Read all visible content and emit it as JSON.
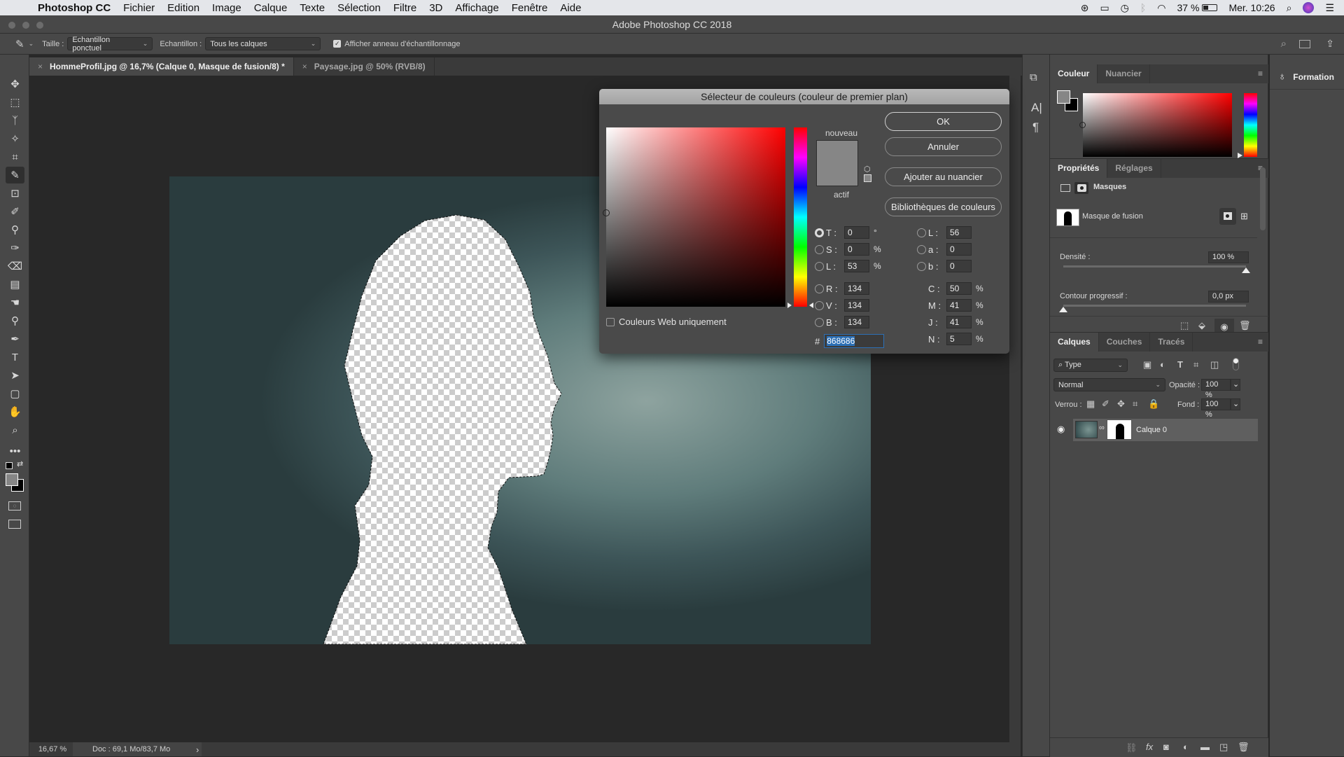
{
  "menubar": {
    "app": "Photoshop CC",
    "items": [
      "Fichier",
      "Edition",
      "Image",
      "Calque",
      "Texte",
      "Sélection",
      "Filtre",
      "3D",
      "Affichage",
      "Fenêtre",
      "Aide"
    ],
    "battery": "37 %",
    "clock": "Mer. 10:26"
  },
  "window": {
    "title": "Adobe Photoshop CC 2018"
  },
  "options": {
    "size_label": "Taille :",
    "size_value": "Echantillon ponctuel",
    "sample_label": "Echantillon :",
    "sample_value": "Tous les calques",
    "show_ring_label": "Afficher anneau d'échantillonnage",
    "show_ring_checked": true
  },
  "tabs": [
    {
      "label": "HommeProfil.jpg @ 16,7% (Calque 0, Masque de fusion/8) *",
      "active": true
    },
    {
      "label": "Paysage.jpg @ 50% (RVB/8)",
      "active": false
    }
  ],
  "status": {
    "zoom": "16,67 %",
    "doc": "Doc : 69,1 Mo/83,7 Mo",
    "arrow": "›"
  },
  "tools": [
    "move-icon",
    "marquee-icon",
    "lasso-icon",
    "magic-wand-icon",
    "crop-icon",
    "eyedropper-icon",
    "frame-icon",
    "brush-icon",
    "stamp-icon",
    "history-brush-icon",
    "eraser-icon",
    "gradient-icon",
    "smudge-icon",
    "dodge-icon",
    "pen-icon",
    "type-icon",
    "path-select-icon",
    "shape-icon",
    "hand-icon",
    "zoom-icon",
    "more-icon"
  ],
  "tool_glyphs": [
    "✥",
    "⬚",
    "ᛉ",
    "✧",
    "⌗",
    "✎",
    "⊡",
    "✐",
    "⚲",
    "✑",
    "⌫",
    "▤",
    "☚",
    "⚲",
    "✒",
    "T",
    "➤",
    "▢",
    "✋",
    "⌕",
    "•••"
  ],
  "colors": {
    "foreground": "#868686",
    "background": "#000000",
    "highlight": "#2c6fb5"
  },
  "dialog": {
    "title": "Sélecteur de couleurs (couleur de premier plan)",
    "buttons": {
      "ok": "OK",
      "cancel": "Annuler",
      "add_swatch": "Ajouter au nuancier",
      "libraries": "Bibliothèques de couleurs"
    },
    "new_label": "nouveau",
    "current_label": "actif",
    "web_only_label": "Couleurs Web uniquement",
    "web_only_checked": false,
    "hsb": [
      {
        "label": "T :",
        "value": "0",
        "unit": "°",
        "selected": true
      },
      {
        "label": "S :",
        "value": "0",
        "unit": "%",
        "selected": false
      },
      {
        "label": "L :",
        "value": "53",
        "unit": "%",
        "selected": false
      }
    ],
    "rgb": [
      {
        "label": "R :",
        "value": "134"
      },
      {
        "label": "V :",
        "value": "134"
      },
      {
        "label": "B :",
        "value": "134"
      }
    ],
    "lab": [
      {
        "label": "L :",
        "value": "56"
      },
      {
        "label": "a :",
        "value": "0"
      },
      {
        "label": "b :",
        "value": "0"
      }
    ],
    "cmyk": [
      {
        "label": "C :",
        "value": "50",
        "unit": "%"
      },
      {
        "label": "M :",
        "value": "41",
        "unit": "%"
      },
      {
        "label": "J :",
        "value": "41",
        "unit": "%"
      },
      {
        "label": "N :",
        "value": "5",
        "unit": "%"
      }
    ],
    "hex_label": "#",
    "hex_value": "868686",
    "hue_degrees": 0
  },
  "color_panel": {
    "tabs": [
      "Couleur",
      "Nuancier"
    ]
  },
  "properties": {
    "tabs": [
      "Propriétés",
      "Réglages"
    ],
    "section": "Masques",
    "mask_name": "Masque de fusion",
    "density_label": "Densité :",
    "density_value": "100 %",
    "density_fraction": 1.0,
    "feather_label": "Contour progressif :",
    "feather_value": "0,0 px",
    "feather_fraction": 0.0
  },
  "layers": {
    "tabs": [
      "Calques",
      "Couches",
      "Tracés"
    ],
    "filter": "Type",
    "blend_mode": "Normal",
    "opacity_label": "Opacité :",
    "opacity_value": "100 %",
    "lock_label": "Verrou :",
    "fill_label": "Fond :",
    "fill_value": "100 %",
    "items": [
      {
        "name": "Calque 0",
        "visible": true,
        "has_mask": true
      }
    ]
  },
  "formation": {
    "label": "Formation"
  }
}
